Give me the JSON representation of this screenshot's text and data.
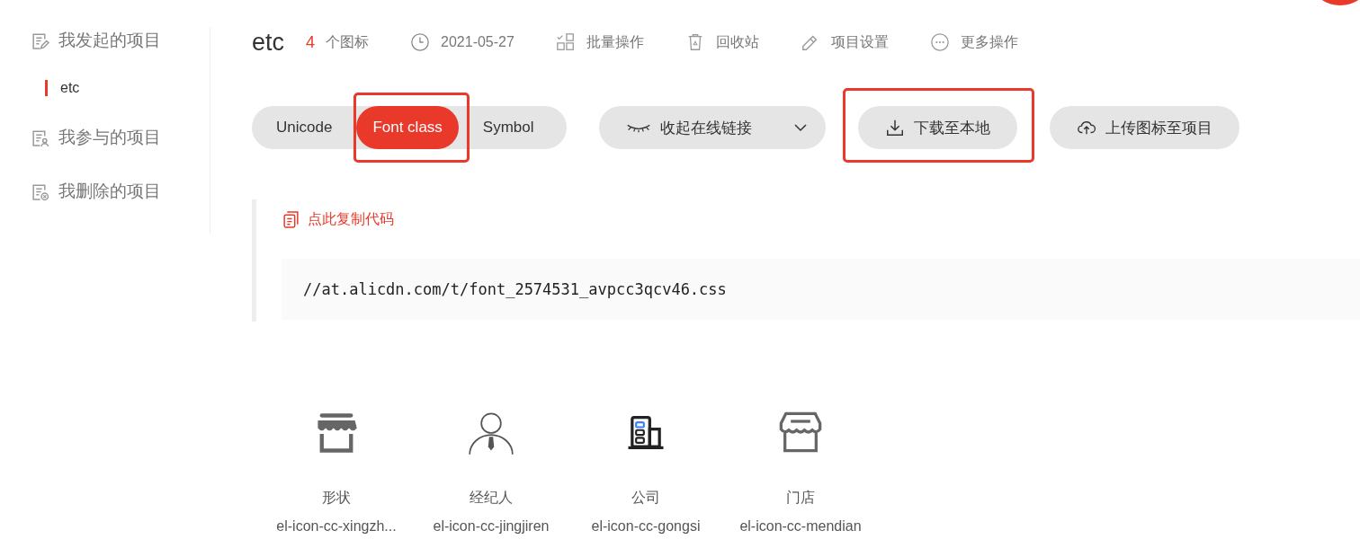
{
  "sidebar": {
    "groups": [
      {
        "kind": "created",
        "label": "我发起的项目",
        "children": [
          {
            "label": "etc",
            "selected": true
          }
        ]
      },
      {
        "kind": "joined",
        "label": "我参与的项目"
      },
      {
        "kind": "deleted",
        "label": "我删除的项目"
      }
    ]
  },
  "header": {
    "title": "etc",
    "count": "4",
    "count_label": "个图标",
    "date": "2021-05-27",
    "actions": [
      {
        "kind": "batch",
        "label": "批量操作"
      },
      {
        "kind": "trash",
        "label": "回收站"
      },
      {
        "kind": "settings",
        "label": "项目设置"
      },
      {
        "kind": "more",
        "label": "更多操作"
      }
    ]
  },
  "tabs": [
    {
      "label": "Unicode",
      "selected": false,
      "highlighted": false
    },
    {
      "label": "Font class",
      "selected": true,
      "highlighted": true
    },
    {
      "label": "Symbol",
      "selected": false,
      "highlighted": false
    }
  ],
  "buttons": [
    {
      "kind": "collapse",
      "label": "收起在线链接",
      "highlighted": false
    },
    {
      "kind": "download",
      "label": "下载至本地",
      "highlighted": true
    },
    {
      "kind": "upload",
      "label": "上传图标至项目",
      "highlighted": false
    }
  ],
  "code_panel": {
    "copy_label": "点此复制代码",
    "code": "//at.alicdn.com/t/font_2574531_avpcc3qcv46.css"
  },
  "icons": [
    {
      "kind": "store-filled",
      "name": "形状",
      "class_name": "el-icon-cc-xingzh..."
    },
    {
      "kind": "person",
      "name": "经纪人",
      "class_name": "el-icon-cc-jingjiren"
    },
    {
      "kind": "building",
      "name": "公司",
      "class_name": "el-icon-cc-gongsi"
    },
    {
      "kind": "store-outline",
      "name": "门店",
      "class_name": "el-icon-cc-mendian"
    }
  ]
}
